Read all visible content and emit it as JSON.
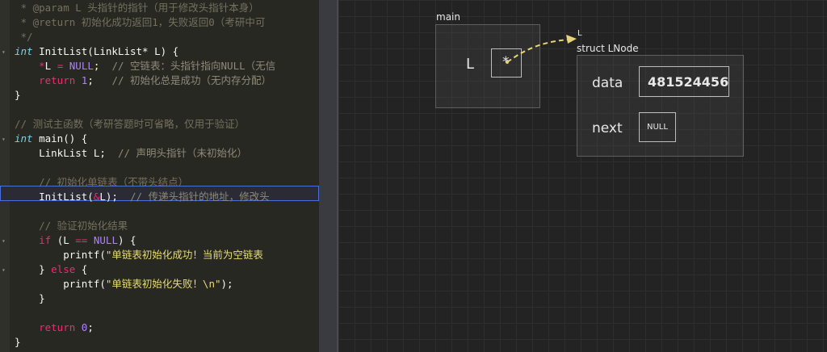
{
  "editor": {
    "lines": [
      {
        "id": "l1",
        "parts": [
          [
            "cm",
            " * @param L 头指针的指针（用于修改头指针本身）"
          ]
        ]
      },
      {
        "id": "l2",
        "parts": [
          [
            "cm",
            " * @return 初始化成功返回1，失败返回0（考研中可"
          ]
        ]
      },
      {
        "id": "l3",
        "parts": [
          [
            "cm",
            " */"
          ]
        ]
      },
      {
        "id": "l4",
        "parts": [
          [
            "kw",
            "int"
          ],
          [
            "plain",
            " InitList(LinkList* L) {"
          ]
        ]
      },
      {
        "id": "l5",
        "parts": [
          [
            "plain",
            "    "
          ],
          [
            "op",
            "*"
          ],
          [
            "plain",
            "L "
          ],
          [
            "op",
            "="
          ],
          [
            "plain",
            " "
          ],
          [
            "num",
            "NULL"
          ],
          [
            "plain",
            ";  "
          ],
          [
            "cm2",
            "// 空链表：头指针指向NULL（无信"
          ]
        ]
      },
      {
        "id": "l6",
        "parts": [
          [
            "plain",
            "    "
          ],
          [
            "ret",
            "return"
          ],
          [
            "plain",
            " "
          ],
          [
            "num",
            "1"
          ],
          [
            "plain",
            ";   "
          ],
          [
            "cm2",
            "// 初始化总是成功（无内存分配）"
          ]
        ]
      },
      {
        "id": "l7",
        "parts": [
          [
            "plain",
            "}"
          ]
        ]
      },
      {
        "id": "l8",
        "parts": [
          [
            "plain",
            ""
          ]
        ]
      },
      {
        "id": "l9",
        "parts": [
          [
            "cm",
            "// 测试主函数（考研答题时可省略，仅用于验证）"
          ]
        ]
      },
      {
        "id": "l10",
        "parts": [
          [
            "kw",
            "int"
          ],
          [
            "plain",
            " main() {"
          ]
        ]
      },
      {
        "id": "l11",
        "parts": [
          [
            "plain",
            "    LinkList L;  "
          ],
          [
            "cm2",
            "// 声明头指针（未初始化）"
          ]
        ]
      },
      {
        "id": "l12",
        "parts": [
          [
            "plain",
            ""
          ]
        ]
      },
      {
        "id": "l13",
        "parts": [
          [
            "plain",
            "    "
          ],
          [
            "cm",
            "// 初始化单链表（不带头结点）"
          ]
        ]
      },
      {
        "id": "l14",
        "parts": [
          [
            "plain",
            "    InitList("
          ],
          [
            "op",
            "&"
          ],
          [
            "plain",
            "L);  "
          ],
          [
            "cm2",
            "// 传递头指针的地址，修改头"
          ]
        ]
      },
      {
        "id": "l15",
        "parts": [
          [
            "plain",
            ""
          ]
        ]
      },
      {
        "id": "l16",
        "parts": [
          [
            "plain",
            "    "
          ],
          [
            "cm",
            "// 验证初始化结果"
          ]
        ]
      },
      {
        "id": "l17",
        "parts": [
          [
            "plain",
            "    "
          ],
          [
            "ret",
            "if"
          ],
          [
            "plain",
            " (L "
          ],
          [
            "op",
            "=="
          ],
          [
            "plain",
            " "
          ],
          [
            "num",
            "NULL"
          ],
          [
            "plain",
            ") {"
          ]
        ]
      },
      {
        "id": "l18",
        "parts": [
          [
            "plain",
            "        printf("
          ],
          [
            "str",
            "\"单链表初始化成功！当前为空链表"
          ]
        ]
      },
      {
        "id": "l19",
        "parts": [
          [
            "plain",
            "    } "
          ],
          [
            "ret",
            "else"
          ],
          [
            "plain",
            " {"
          ]
        ]
      },
      {
        "id": "l20",
        "parts": [
          [
            "plain",
            "        printf("
          ],
          [
            "str",
            "\"单链表初始化失败！\\n\""
          ],
          [
            "plain",
            ");"
          ]
        ]
      },
      {
        "id": "l21",
        "parts": [
          [
            "plain",
            "    }"
          ]
        ]
      },
      {
        "id": "l22",
        "parts": [
          [
            "plain",
            ""
          ]
        ]
      },
      {
        "id": "l23",
        "parts": [
          [
            "plain",
            "    "
          ],
          [
            "ret",
            "return"
          ],
          [
            "plain",
            " "
          ],
          [
            "num",
            "0"
          ],
          [
            "plain",
            ";"
          ]
        ]
      },
      {
        "id": "l24",
        "parts": [
          [
            "plain",
            "}"
          ]
        ]
      }
    ]
  },
  "memory": {
    "main_frame": {
      "title": "main",
      "var_name": "L",
      "pointer_symbol": "*"
    },
    "node": {
      "pointer_label": "L",
      "title": "struct LNode",
      "data_label": "data",
      "data_value": "481524456",
      "next_label": "next",
      "next_value": "NULL"
    },
    "colors": {
      "arrow": "#e6d37a",
      "canvas": "#232323"
    }
  }
}
